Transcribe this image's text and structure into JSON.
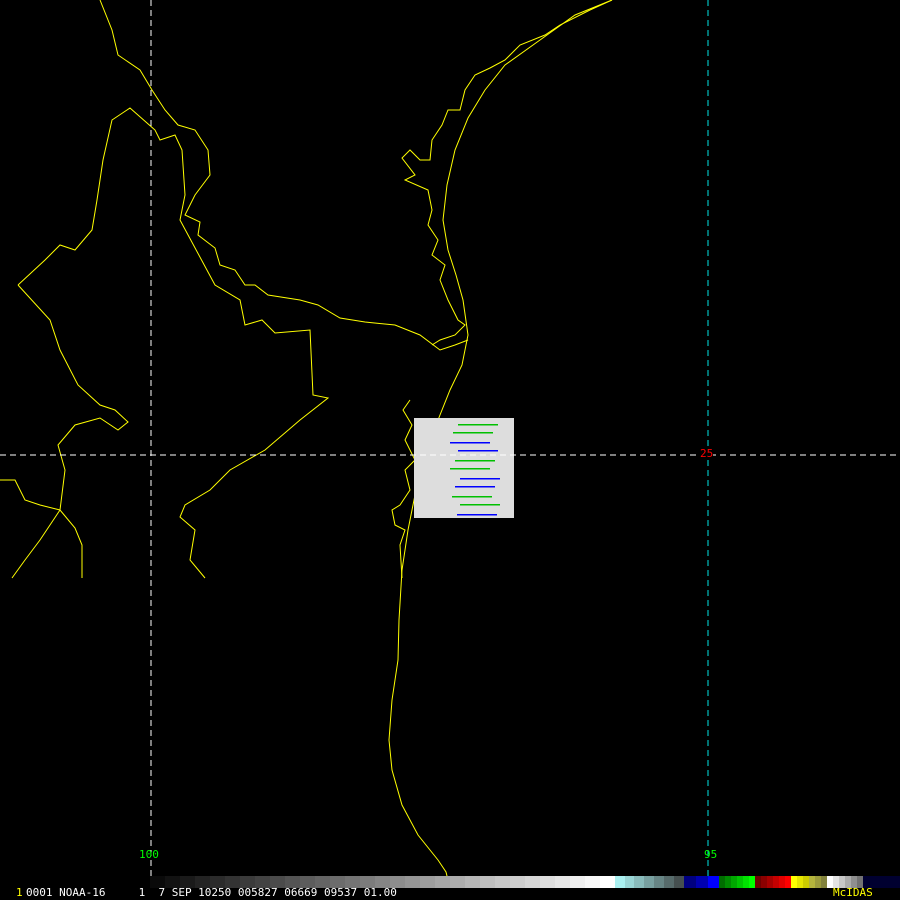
{
  "grid_labels": {
    "lon_100": "100",
    "lon_95": "95",
    "lat_25": "25"
  },
  "footer": {
    "frame_number": "1",
    "info": "0001 NOAA-16     1  7 SEP 10250 005827 06669 09537 01.00",
    "brand": "McIDAS"
  },
  "colors": {
    "coast": "#ffff00",
    "grid_white": "#ffffff",
    "grid_cyan": "#00e5e5",
    "lon_label": "#00ff00",
    "lat_label": "#ff0000",
    "brand": "#ffff00"
  }
}
